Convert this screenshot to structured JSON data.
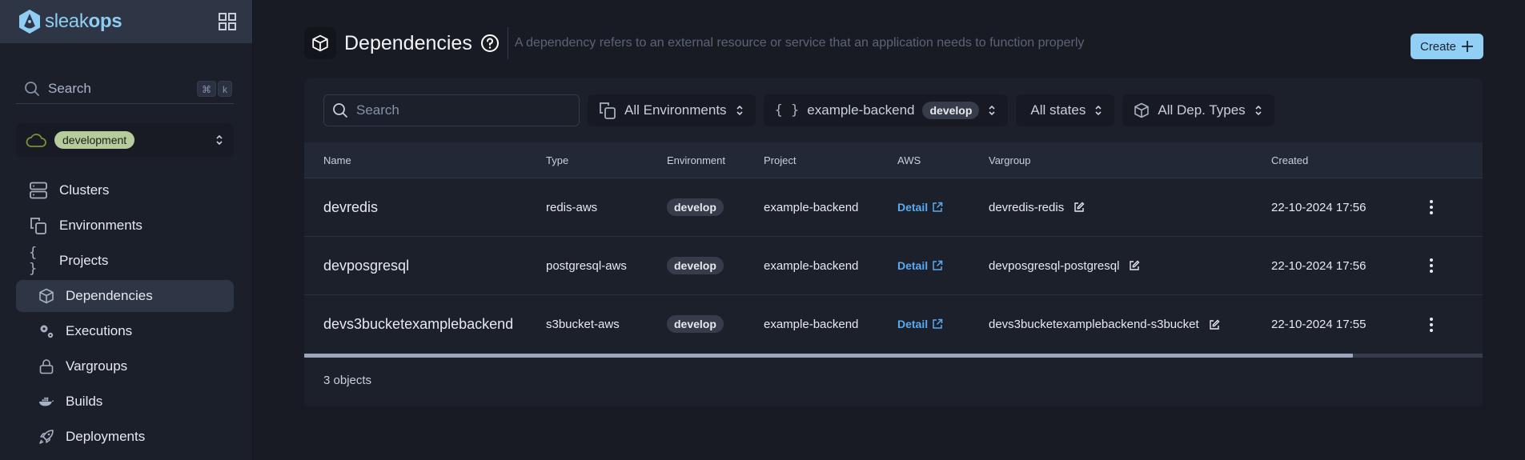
{
  "app": {
    "brand_light": "sleak",
    "brand_bold": "ops"
  },
  "sidebar": {
    "search_placeholder": "Search",
    "shortcut_keys": [
      "⌘",
      "k"
    ],
    "environment": "development",
    "items": [
      {
        "label": "Clusters",
        "icon": "server-icon"
      },
      {
        "label": "Environments",
        "icon": "copy-icon"
      },
      {
        "label": "Projects",
        "icon": "braces-icon"
      },
      {
        "label": "Dependencies",
        "icon": "cube-icon",
        "active": true
      },
      {
        "label": "Executions",
        "icon": "gears-icon"
      },
      {
        "label": "Vargroups",
        "icon": "lock-icon"
      },
      {
        "label": "Builds",
        "icon": "docker-icon"
      },
      {
        "label": "Deployments",
        "icon": "rocket-icon"
      }
    ]
  },
  "header": {
    "title": "Dependencies",
    "description": "A dependency refers to an external resource or service that an application needs to function properly",
    "create_label": "Create"
  },
  "filters": {
    "search_placeholder": "Search",
    "environment": "All Environments",
    "project": "example-backend",
    "project_tag": "develop",
    "state": "All states",
    "dep_type": "All Dep. Types"
  },
  "table": {
    "columns": [
      "Name",
      "Type",
      "Environment",
      "Project",
      "AWS",
      "Vargroup",
      "Created"
    ],
    "rows": [
      {
        "name": "devredis",
        "type": "redis-aws",
        "environment": "develop",
        "project": "example-backend",
        "aws": "Detail",
        "vargroup": "devredis-redis",
        "created": "22-10-2024 17:56"
      },
      {
        "name": "devposgresql",
        "type": "postgresql-aws",
        "environment": "develop",
        "project": "example-backend",
        "aws": "Detail",
        "vargroup": "devposgresql-postgresql",
        "created": "22-10-2024 17:56"
      },
      {
        "name": "devs3bucketexamplebackend",
        "type": "s3bucket-aws",
        "environment": "develop",
        "project": "example-backend",
        "aws": "Detail",
        "vargroup": "devs3bucketexamplebackend-s3bucket",
        "created": "22-10-2024 17:55"
      }
    ],
    "horizontal_scroll_visible_fraction": 0.89,
    "footer_count": "3 objects"
  },
  "colors": {
    "accent": "#92cff4",
    "link": "#5aaaf0",
    "env_badge": "#b6cc9c",
    "sidebar_bg": "#1b1f29",
    "main_bg": "#181b23"
  }
}
